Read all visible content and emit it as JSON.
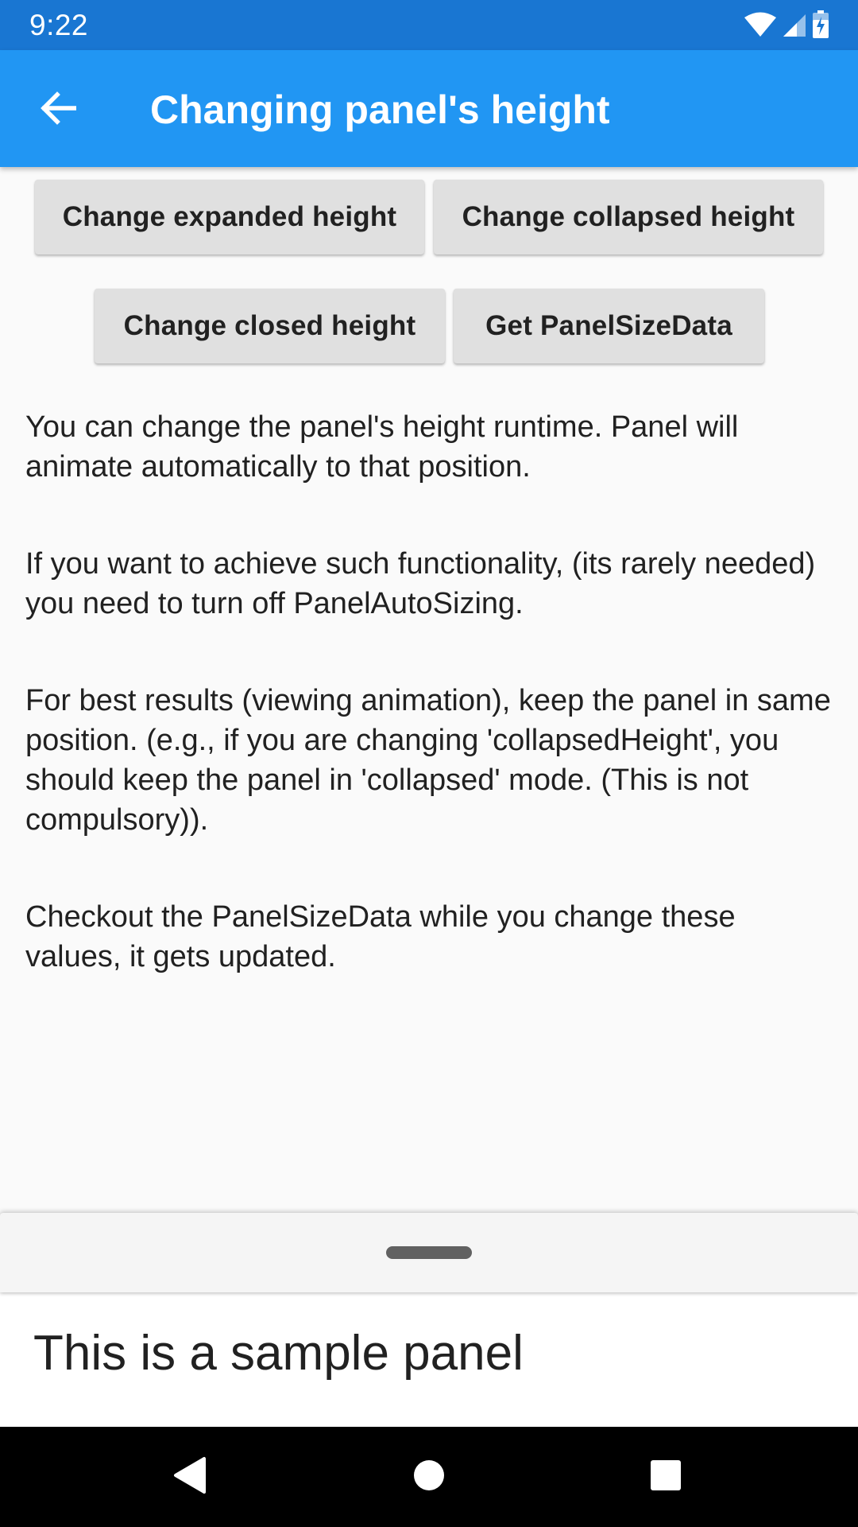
{
  "status_bar": {
    "time": "9:22",
    "icons": [
      "wifi-icon",
      "cell-signal-icon",
      "battery-charging-icon"
    ]
  },
  "app_bar": {
    "back_icon": "arrow-back-icon",
    "title": "Changing panel's height",
    "background": "#2196f3"
  },
  "buttons": {
    "change_expanded": "Change expanded height",
    "change_collapsed": "Change collapsed height",
    "change_closed": "Change closed height",
    "get_panel_size": "Get PanelSizeData"
  },
  "paragraphs": [
    "You can change the panel's height runtime. Panel will animate automatically to that position.",
    "If you want to achieve such functionality, (its rarely needed) you need to turn off PanelAutoSizing.",
    "For best results (viewing animation), keep the panel in same position. (e.g., if you are changing 'collapsedHeight', you should keep the panel in 'collapsed' mode. (This is not compulsory)).",
    "Checkout the PanelSizeData while you change these values, it gets updated."
  ],
  "panel": {
    "text": "This is a sample panel"
  },
  "nav_bar": {
    "icons": [
      "back-triangle-icon",
      "home-circle-icon",
      "recents-square-icon"
    ]
  }
}
